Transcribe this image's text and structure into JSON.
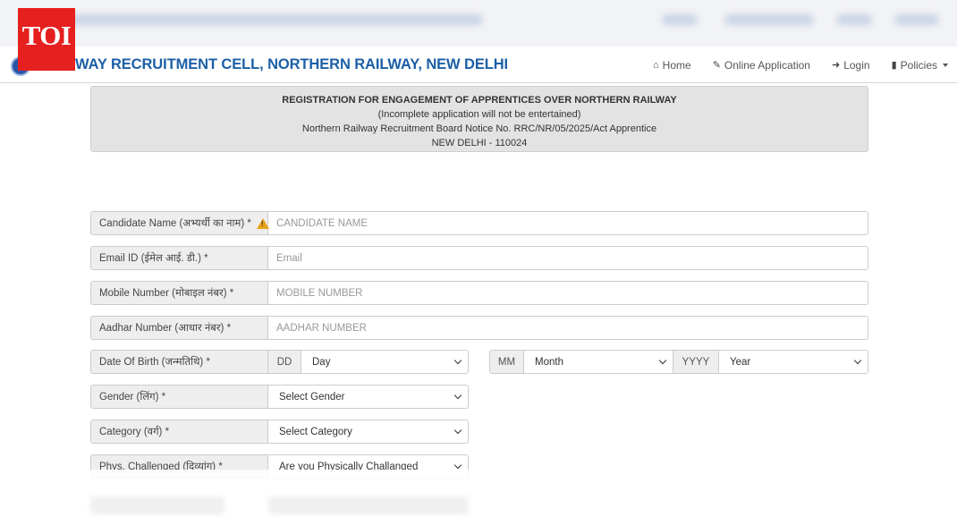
{
  "brand": {
    "toi_logo_text": "TOI",
    "title": "WAY RECRUITMENT CELL, NORTHERN RAILWAY, NEW DELHI"
  },
  "nav": {
    "home": "Home",
    "online_application": "Online Application",
    "login": "Login",
    "policies": "Policies"
  },
  "header": {
    "title": "REGISTRATION FOR ENGAGEMENT OF APPRENTICES OVER NORTHERN RAILWAY",
    "note": "(Incomplete application will not be entertained)",
    "notice": "Northern Railway Recruitment Board Notice No. RRC/NR/05/2025/Act Apprentice",
    "location": "NEW DELHI - 110024"
  },
  "form": {
    "candidate_name": {
      "label": "Candidate Name (अभ्यर्थी का नाम) *",
      "placeholder": "CANDIDATE NAME"
    },
    "email": {
      "label": "Email ID (ईमेल आई. डी.) *",
      "placeholder": "Email"
    },
    "mobile": {
      "label": "Mobile Number (मोबाइल नंबर) *",
      "placeholder": "MOBILE NUMBER"
    },
    "aadhar": {
      "label": "Aadhar Number (आधार नंबर) *",
      "placeholder": "AADHAR NUMBER"
    },
    "dob": {
      "label": "Date Of Birth (जन्मतिथि) *",
      "dd_addon": "DD",
      "day_value": "Day",
      "mm_addon": "MM",
      "month_value": "Month",
      "yyyy_addon": "YYYY",
      "year_value": "Year"
    },
    "gender": {
      "label": "Gender (लिंग) *",
      "value": "Select Gender"
    },
    "category": {
      "label": "Category (वर्ग) *",
      "value": "Select Category"
    },
    "phys_challenged": {
      "label": "Phys. Challenged (दिव्यांग) *",
      "value": "Are you Physically Challanged"
    }
  },
  "colors": {
    "toi_red": "#e61f1f",
    "brand_blue": "#1c5fa6",
    "warning": "#e8a317"
  }
}
